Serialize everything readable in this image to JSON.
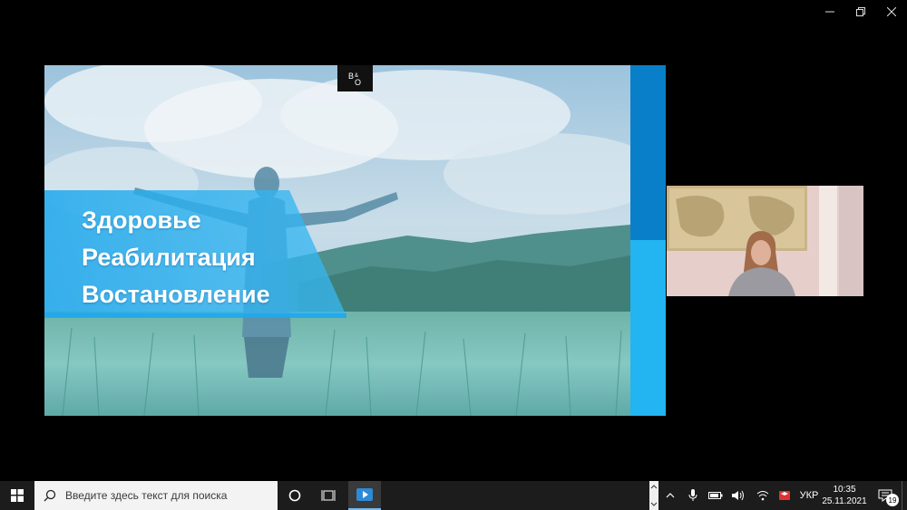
{
  "slide": {
    "logo_text": "B&O",
    "banner_lines": [
      "Здоровье",
      "Реабилитация",
      "Востановление"
    ],
    "colors": {
      "strip_top": "#0a7fc9",
      "strip_bottom": "#22b5f1",
      "banner": "#1fa8ec"
    }
  },
  "window_controls": {
    "minimize": "minimize-icon",
    "restore": "restore-icon",
    "close": "close-icon"
  },
  "taskbar": {
    "search_placeholder": "Введите здесь текст для поиска",
    "language": "УКР",
    "time": "10:35",
    "date": "25.11.2021",
    "notification_count": "19"
  }
}
